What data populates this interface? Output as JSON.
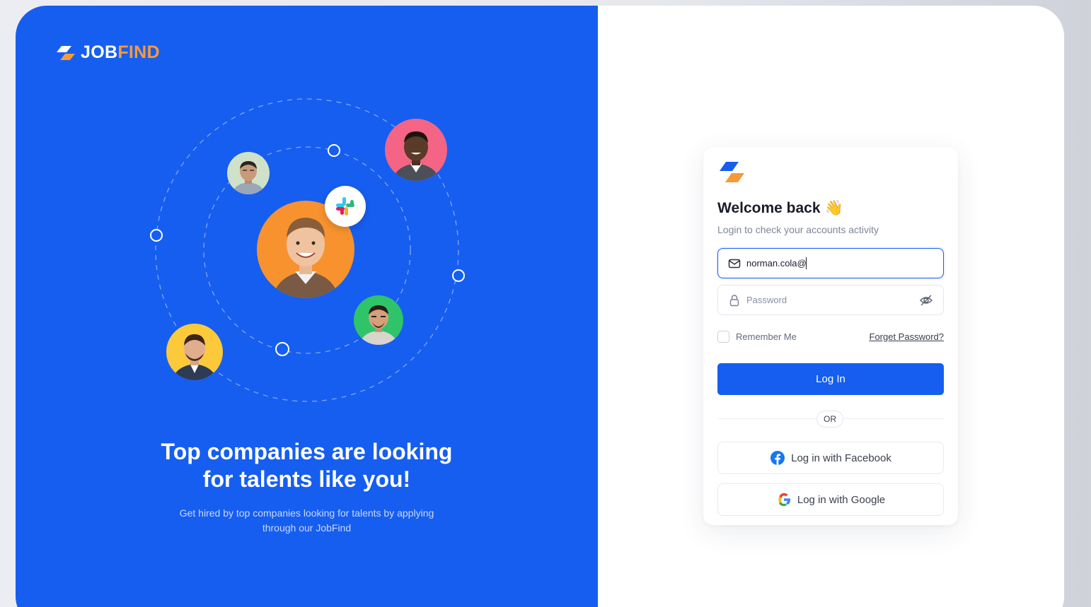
{
  "brand": {
    "name_part1": "JOB",
    "name_part2": "FIND"
  },
  "hero": {
    "headline_line1": "Top companies are looking",
    "headline_line2": "for talents like you!",
    "subtext_line1": "Get hired by top companies looking for talents by applying",
    "subtext_line2": "through our JobFind"
  },
  "login": {
    "title": "Welcome back",
    "title_emoji": "👋",
    "subtitle": "Login to check your accounts activity",
    "email_value": "norman.cola@",
    "password_placeholder": "Password",
    "remember_label": "Remember Me",
    "forgot_label": "Forget Password?",
    "login_button": "Log In",
    "or_label": "OR",
    "facebook_button": "Log in with Facebook",
    "google_button": "Log in with Google"
  },
  "colors": {
    "primary": "#165ef0",
    "accent_orange": "#f79a3a",
    "avatar_orange": "#f7922e",
    "avatar_pink": "#f46585",
    "avatar_green": "#2fc46a",
    "avatar_yellow": "#fbc93a",
    "avatar_sage": "#cfe2c9"
  },
  "icons": [
    "jobfind-logo-icon",
    "mail-icon",
    "lock-icon",
    "eye-off-icon",
    "slack-icon",
    "facebook-icon",
    "google-icon"
  ]
}
